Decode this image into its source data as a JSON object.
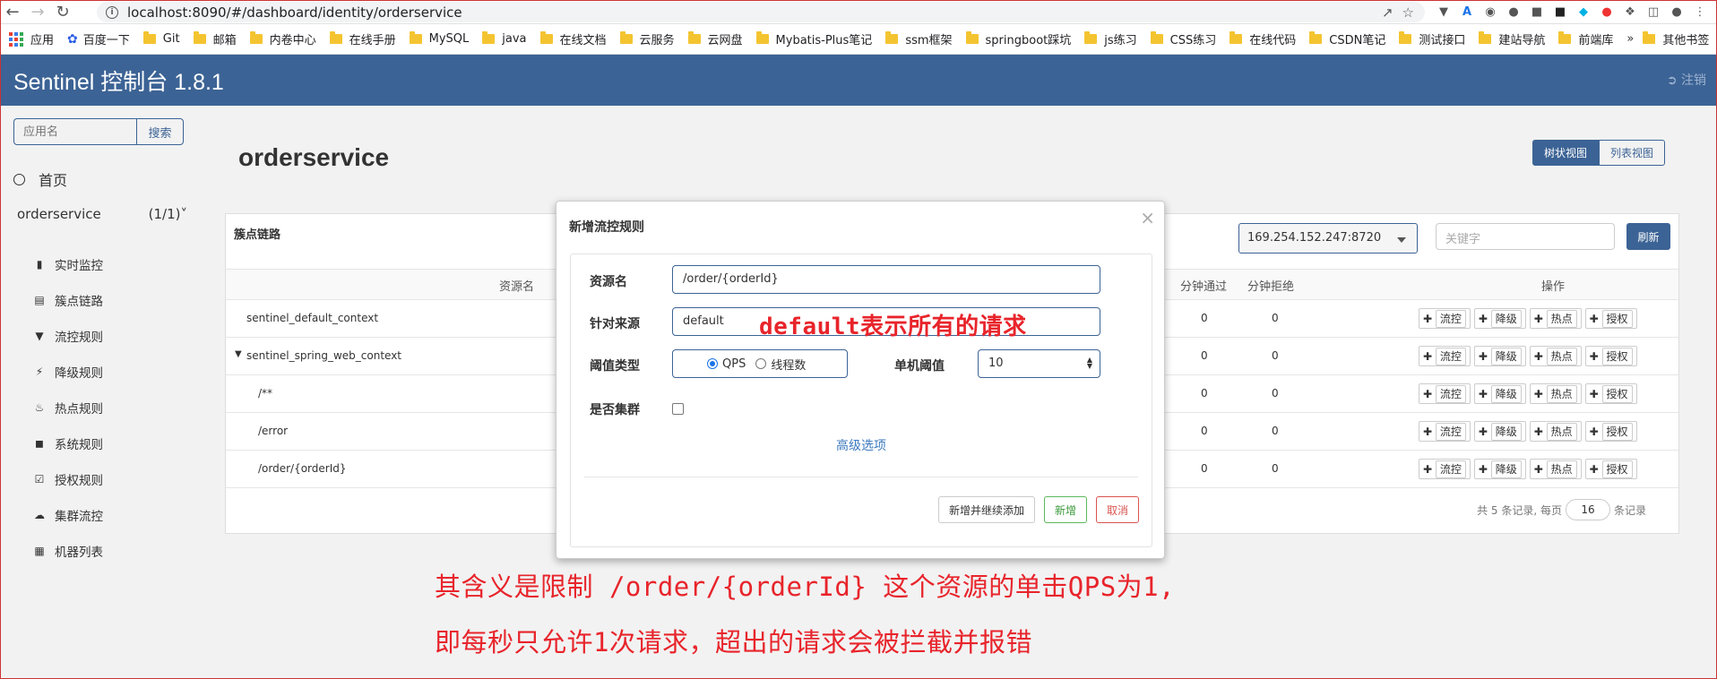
{
  "browser": {
    "url": "localhost:8090/#/dashboard/identity/orderservice",
    "bookmarks": [
      "应用",
      "百度一下",
      "Git",
      "邮箱",
      "内卷中心",
      "在线手册",
      "MySQL",
      "java",
      "在线文档",
      "云服务",
      "云网盘",
      "Mybatis-Plus笔记",
      "ssm框架",
      "springboot踩坑",
      "js练习",
      "CSS练习",
      "在线代码",
      "CSDN笔记",
      "测试接口",
      "建站导航",
      "前端库"
    ],
    "bookmarks_more": "»",
    "other_bookmarks": "其他书签"
  },
  "header": {
    "title": "Sentinel 控制台 1.8.1",
    "logout": "注销"
  },
  "sidebar": {
    "search_placeholder": "应用名",
    "search_button": "搜索",
    "home": "首页",
    "app_name": "orderservice",
    "app_count": "(1/1)",
    "items": [
      {
        "label": "实时监控",
        "icon": "bar-chart-icon"
      },
      {
        "label": "簇点链路",
        "icon": "list-icon"
      },
      {
        "label": "流控规则",
        "icon": "filter-icon"
      },
      {
        "label": "降级规则",
        "icon": "flash-icon"
      },
      {
        "label": "热点规则",
        "icon": "fire-icon"
      },
      {
        "label": "系统规则",
        "icon": "lock-icon"
      },
      {
        "label": "授权规则",
        "icon": "check-icon"
      },
      {
        "label": "集群流控",
        "icon": "cloud-icon"
      },
      {
        "label": "机器列表",
        "icon": "grid-icon"
      }
    ]
  },
  "main": {
    "title": "orderservice",
    "view_tree": "树状视图",
    "view_list": "列表视图",
    "panel_label": "簇点链路",
    "machine": "169.254.152.247:8720",
    "keyword_placeholder": "关键字",
    "refresh": "刷新",
    "columns": {
      "resource": "资源名",
      "pass_min": "分钟通过",
      "reject_min": "分钟拒绝",
      "ops": "操作"
    },
    "rows": [
      {
        "name": "sentinel_default_context",
        "pass": "0",
        "reject": "0"
      },
      {
        "name": "sentinel_spring_web_context",
        "pass": "0",
        "reject": "0"
      },
      {
        "name": "/**",
        "pass": "0",
        "reject": "0"
      },
      {
        "name": "/error",
        "pass": "0",
        "reject": "0"
      },
      {
        "name": "/order/{orderId}",
        "pass": "0",
        "reject": "0"
      }
    ],
    "op_labels": [
      "流控",
      "降级",
      "热点",
      "授权"
    ],
    "pager_prefix": "共 5 条记录, 每页",
    "pager_size": "16",
    "pager_suffix": "条记录"
  },
  "modal": {
    "title": "新增流控规则",
    "close": "×",
    "resource_label": "资源名",
    "resource_value": "/order/{orderId}",
    "source_label": "针对来源",
    "source_value": "default",
    "threshold_type_label": "阈值类型",
    "qps": "QPS",
    "threads": "线程数",
    "single_threshold_label": "单机阈值",
    "single_threshold_value": "10",
    "cluster_label": "是否集群",
    "advanced": "高级选项",
    "btn_add_continue": "新增并继续添加",
    "btn_add": "新增",
    "btn_cancel": "取消"
  },
  "annotations": {
    "inline": "default表示所有的请求",
    "line1": "其含义是限制 /order/{orderId} 这个资源的单击QPS为1,",
    "line2": "即每秒只允许1次请求，超出的请求会被拦截并报错"
  },
  "colors": {
    "header_bg": "#3c6395",
    "annotation": "#e8242b",
    "primary": "#3c6395"
  }
}
